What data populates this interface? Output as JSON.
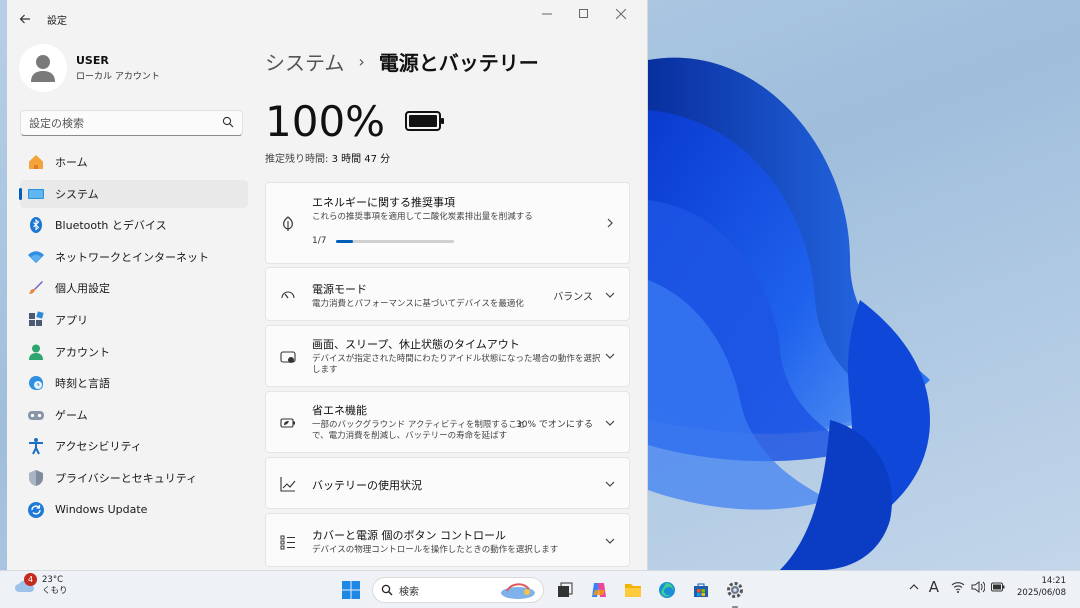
{
  "window": {
    "app_title": "設定",
    "back_icon": "back-arrow-icon",
    "controls": [
      "minimize",
      "maximize",
      "close"
    ]
  },
  "sidebar": {
    "user_name": "USER",
    "user_account_type": "ローカル アカウント",
    "search_placeholder": "設定の検索",
    "items": [
      {
        "label": "ホーム",
        "icon": "home-icon",
        "active": false
      },
      {
        "label": "システム",
        "icon": "system-icon",
        "active": true
      },
      {
        "label": "Bluetooth とデバイス",
        "icon": "bluetooth-icon",
        "active": false
      },
      {
        "label": "ネットワークとインターネット",
        "icon": "network-icon",
        "active": false
      },
      {
        "label": "個人用設定",
        "icon": "brush-icon",
        "active": false
      },
      {
        "label": "アプリ",
        "icon": "apps-icon",
        "active": false
      },
      {
        "label": "アカウント",
        "icon": "account-icon",
        "active": false
      },
      {
        "label": "時刻と言語",
        "icon": "globe-clock-icon",
        "active": false
      },
      {
        "label": "ゲーム",
        "icon": "gamepad-icon",
        "active": false
      },
      {
        "label": "アクセシビリティ",
        "icon": "accessibility-icon",
        "active": false
      },
      {
        "label": "プライバシーとセキュリティ",
        "icon": "shield-icon",
        "active": false
      },
      {
        "label": "Windows Update",
        "icon": "update-icon",
        "active": false
      }
    ]
  },
  "content": {
    "breadcrumb_parent": "システム",
    "breadcrumb_separator": "›",
    "breadcrumb_current": "電源とバッテリー",
    "battery_percent": "100%",
    "remaining_label": "推定残り時間:",
    "remaining_value": "3 時間 47 分",
    "cards": {
      "recommend": {
        "title": "エネルギーに関する推奨事項",
        "desc": "これらの推奨事項を適用して二酸化炭素排出量を削減する",
        "progress_label": "1/7",
        "progress_fraction": 0.1429
      },
      "power_mode": {
        "title": "電源モード",
        "desc": "電力消費とパフォーマンスに基づいてデバイスを最適化",
        "value": "バランス"
      },
      "screen_sleep": {
        "title": "画面、スリープ、休止状態のタイムアウト",
        "desc": "デバイスが指定された時間にわたりアイドル状態になった場合の動作を選択します"
      },
      "energy_saver": {
        "title": "省エネ機能",
        "desc": "一部のバックグラウンド アクティビティを制限することで、電力消費を削減し、バッテリーの寿命を延ばす",
        "value": "30% でオンにする"
      },
      "usage": {
        "title": "バッテリーの使用状況"
      },
      "lid_power": {
        "title": "カバーと電源 個のボタン コントロール",
        "desc": "デバイスの物理コントロールを操作したときの動作を選択します"
      }
    }
  },
  "taskbar": {
    "weather_temp": "23°C",
    "weather_cond": "くもり",
    "weather_badge": "4",
    "search_placeholder": "検索",
    "ime_label": "A",
    "time": "14:21",
    "date": "2025/06/08",
    "accent": "#005fb8"
  }
}
